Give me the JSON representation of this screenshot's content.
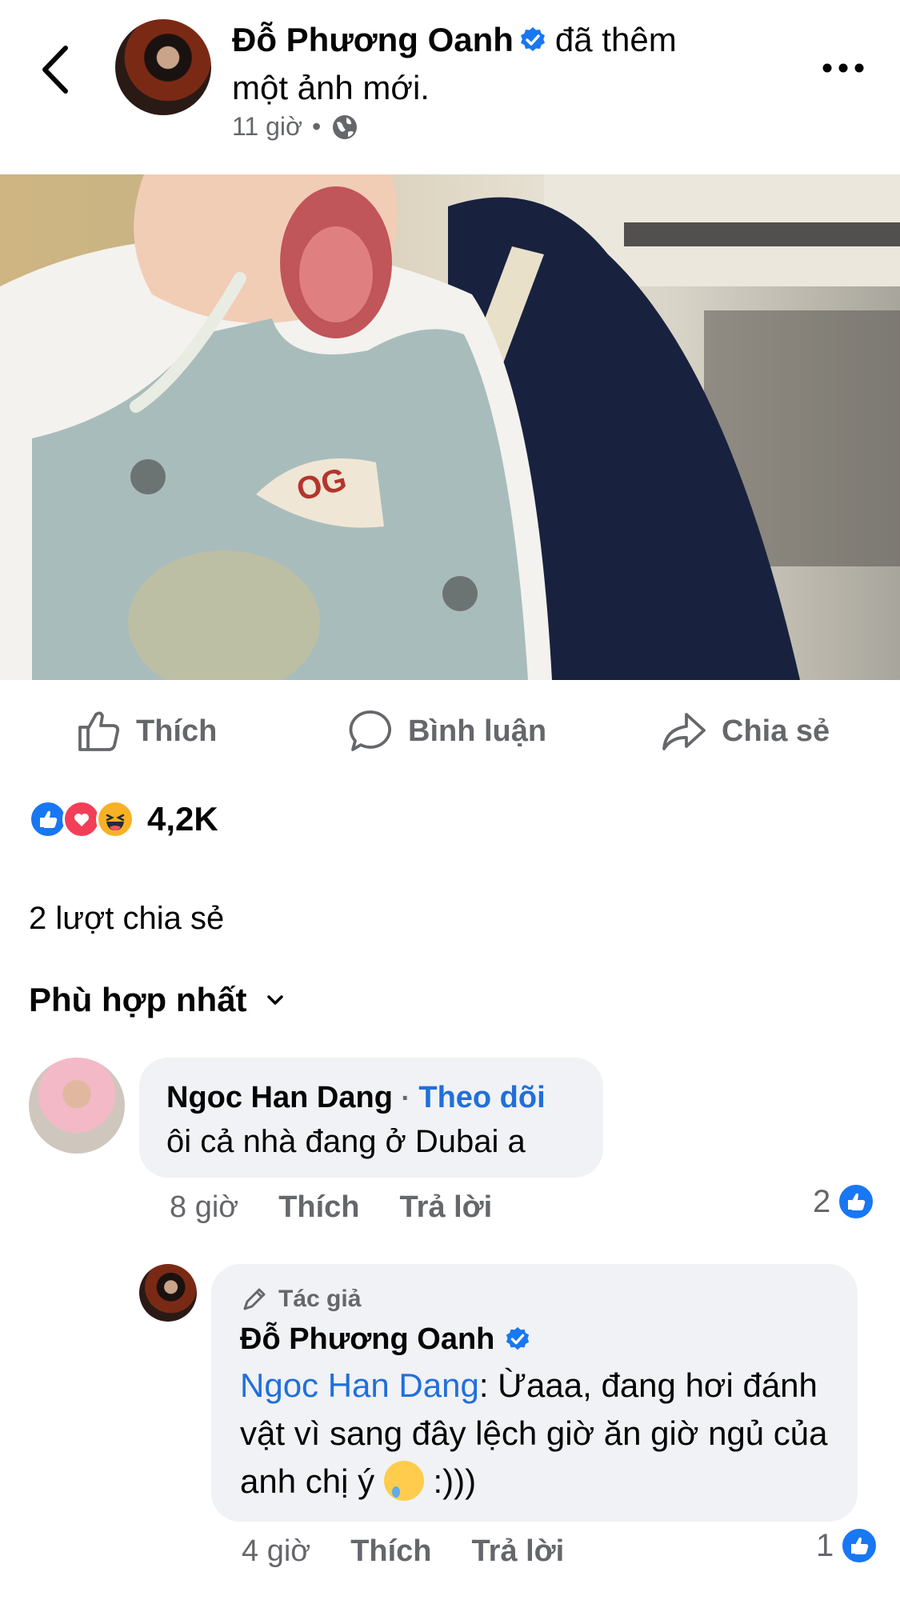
{
  "header": {
    "author_name": "Đỗ Phương Oanh",
    "action_line1": "đã thêm",
    "action_line2": "một ảnh mới.",
    "time": "11 giờ",
    "separator": "•",
    "privacy_icon": "globe-icon"
  },
  "actions": {
    "like": "Thích",
    "comment": "Bình luận",
    "share": "Chia sẻ"
  },
  "reactions": {
    "icons": [
      "like-icon",
      "love-icon",
      "haha-icon"
    ],
    "count": "4,2K"
  },
  "shares_text": "2 lượt chia sẻ",
  "sort_label": "Phù hợp nhất",
  "comments": [
    {
      "name": "Ngoc Han Dang",
      "separator": "·",
      "follow": "Theo dõi",
      "text": "ôi cả nhà đang ở Dubai a",
      "time": "8 giờ",
      "like": "Thích",
      "reply": "Trả lời",
      "likes": "2"
    },
    {
      "author_tag": "Tác giả",
      "name": "Đỗ Phương Oanh",
      "mention": "Ngoc Han Dang",
      "text": ": Ừaaa, đang hơi đánh vật vì sang đây lệch giờ ăn giờ ngủ của anh chị ý",
      "text_after_emoji": " :)))",
      "time": "4 giờ",
      "like": "Thích",
      "reply": "Trả lời",
      "likes": "1"
    }
  ],
  "colors": {
    "accent": "#1877f2",
    "link": "#216fdb",
    "secondary_text": "#65676b",
    "bubble": "#f0f2f5",
    "love": "#f33e58",
    "haha": "#f7b125"
  }
}
